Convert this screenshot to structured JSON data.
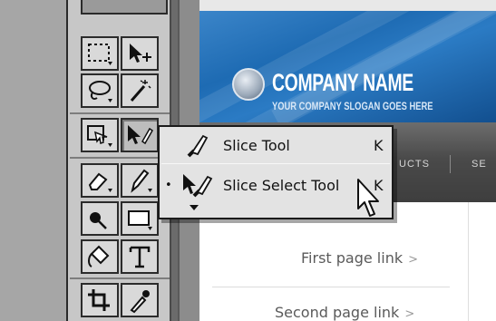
{
  "flyout_menu": {
    "items": [
      {
        "label": "Slice Tool",
        "shortcut": "K",
        "selected": false,
        "icon": "slice-knife-icon"
      },
      {
        "label": "Slice Select Tool",
        "shortcut": "K",
        "selected": true,
        "icon": "slice-select-icon"
      }
    ],
    "more_indicator": "more-tools-arrow-icon"
  },
  "toolbox": {
    "tools": [
      "marquee-icon",
      "move-icon",
      "lasso-icon",
      "magic-wand-icon",
      "slice-tool-icon",
      "slice-select-tool-icon",
      "eraser-icon",
      "pencil-icon",
      "paint-ball-icon",
      "rectangle-icon",
      "paint-bucket-icon",
      "text-icon",
      "crop-icon",
      "eyedropper-icon"
    ]
  },
  "website": {
    "company_name": "COMPANY NAME",
    "slogan": "YOUR COMPANY SLOGAN GOES HERE",
    "nav": [
      "UCTS",
      "SE"
    ],
    "links": [
      {
        "text": "First page link",
        "chevron": ">"
      },
      {
        "text": "Second page link",
        "chevron": ">"
      }
    ],
    "accent_color": "#2a74bd",
    "nav_color": "#4a4a4a"
  }
}
